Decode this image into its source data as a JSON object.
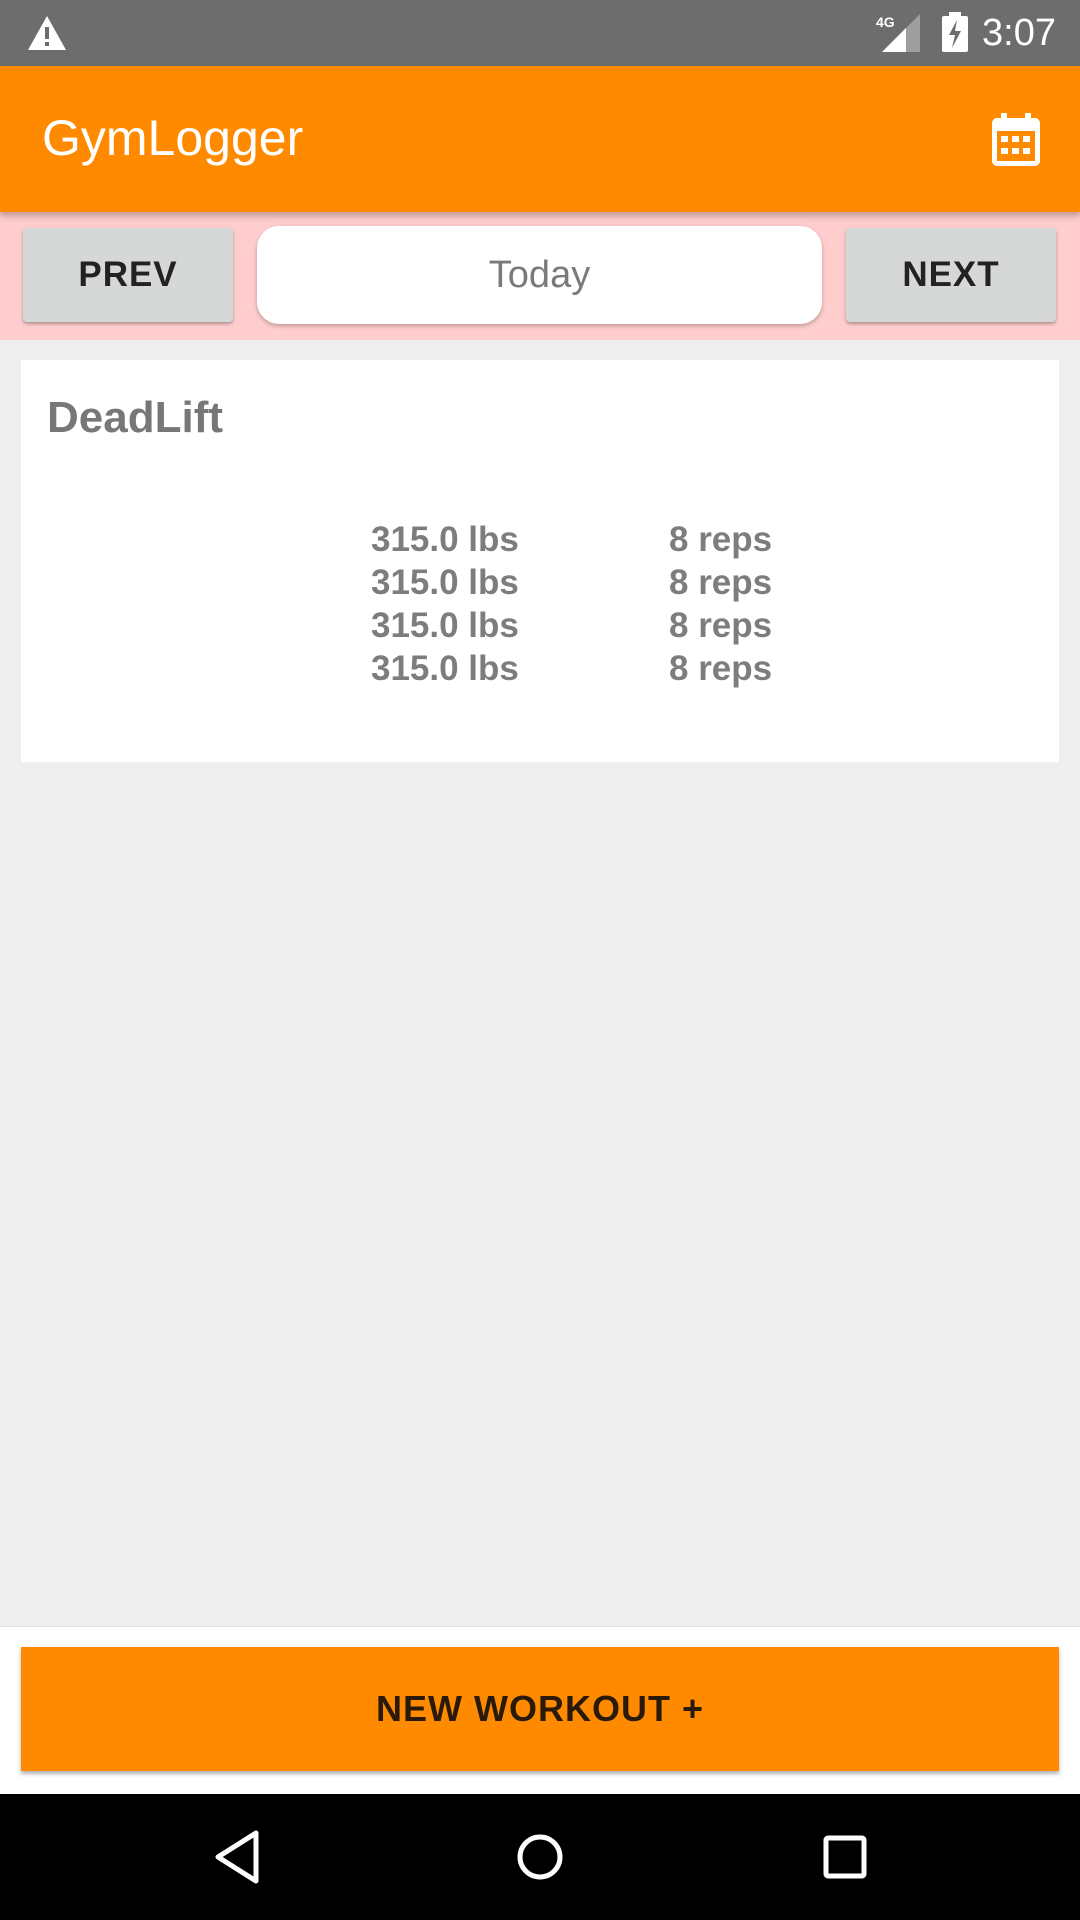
{
  "status_bar": {
    "network_label": "4G",
    "time": "3:07",
    "icons": [
      "warning-icon",
      "signal-icon",
      "battery-charging-icon"
    ]
  },
  "app_bar": {
    "title": "GymLogger",
    "action_icon": "calendar-icon"
  },
  "date_nav": {
    "prev_label": "PREV",
    "date_label": "Today",
    "next_label": "NEXT"
  },
  "workout": {
    "exercise": "DeadLift",
    "sets": [
      {
        "weight": "315.0 lbs",
        "reps": "8 reps"
      },
      {
        "weight": "315.0 lbs",
        "reps": "8 reps"
      },
      {
        "weight": "315.0 lbs",
        "reps": "8 reps"
      },
      {
        "weight": "315.0 lbs",
        "reps": "8 reps"
      }
    ]
  },
  "bottom": {
    "new_workout_label": "NEW WORKOUT +"
  },
  "system_nav": {
    "icons": [
      "back-icon",
      "home-icon",
      "recents-icon"
    ]
  },
  "colors": {
    "accent": "#ff8a00",
    "date_strip": "#ffcdcd",
    "background": "#eeeeee"
  }
}
